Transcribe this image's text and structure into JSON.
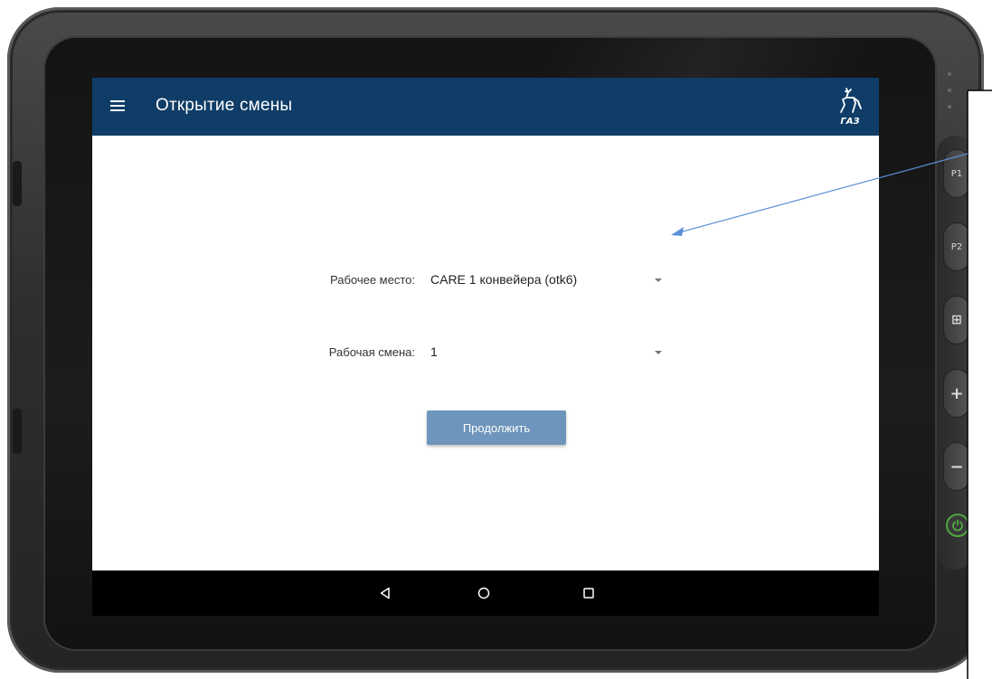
{
  "app_bar": {
    "title": "Открытие смены",
    "logo_text": "ГАЗ",
    "background_color": "#0f3d67",
    "menu_icon": "hamburger-menu-icon",
    "logo_icon": "gaz-deer-logo-icon"
  },
  "form": {
    "workplace": {
      "label": "Рабочее место:",
      "value": "CARE 1 конвейера (otk6)"
    },
    "shift": {
      "label": "Рабочая смена:",
      "value": "1"
    },
    "continue_button": {
      "label": "Продолжить",
      "color": "#6e95bb"
    }
  },
  "nav_bar": {
    "buttons": [
      {
        "name": "back",
        "icon": "triangle-back-icon"
      },
      {
        "name": "home",
        "icon": "circle-home-icon"
      },
      {
        "name": "recents",
        "icon": "square-recents-icon"
      }
    ]
  },
  "hardware_buttons": {
    "labels": [
      "P1",
      "P2",
      "⊞",
      "+",
      "−"
    ],
    "power_icon": "power-icon",
    "power_color": "#4ea73e"
  },
  "annotation": {
    "arrow_color": "#5b8fd6"
  }
}
